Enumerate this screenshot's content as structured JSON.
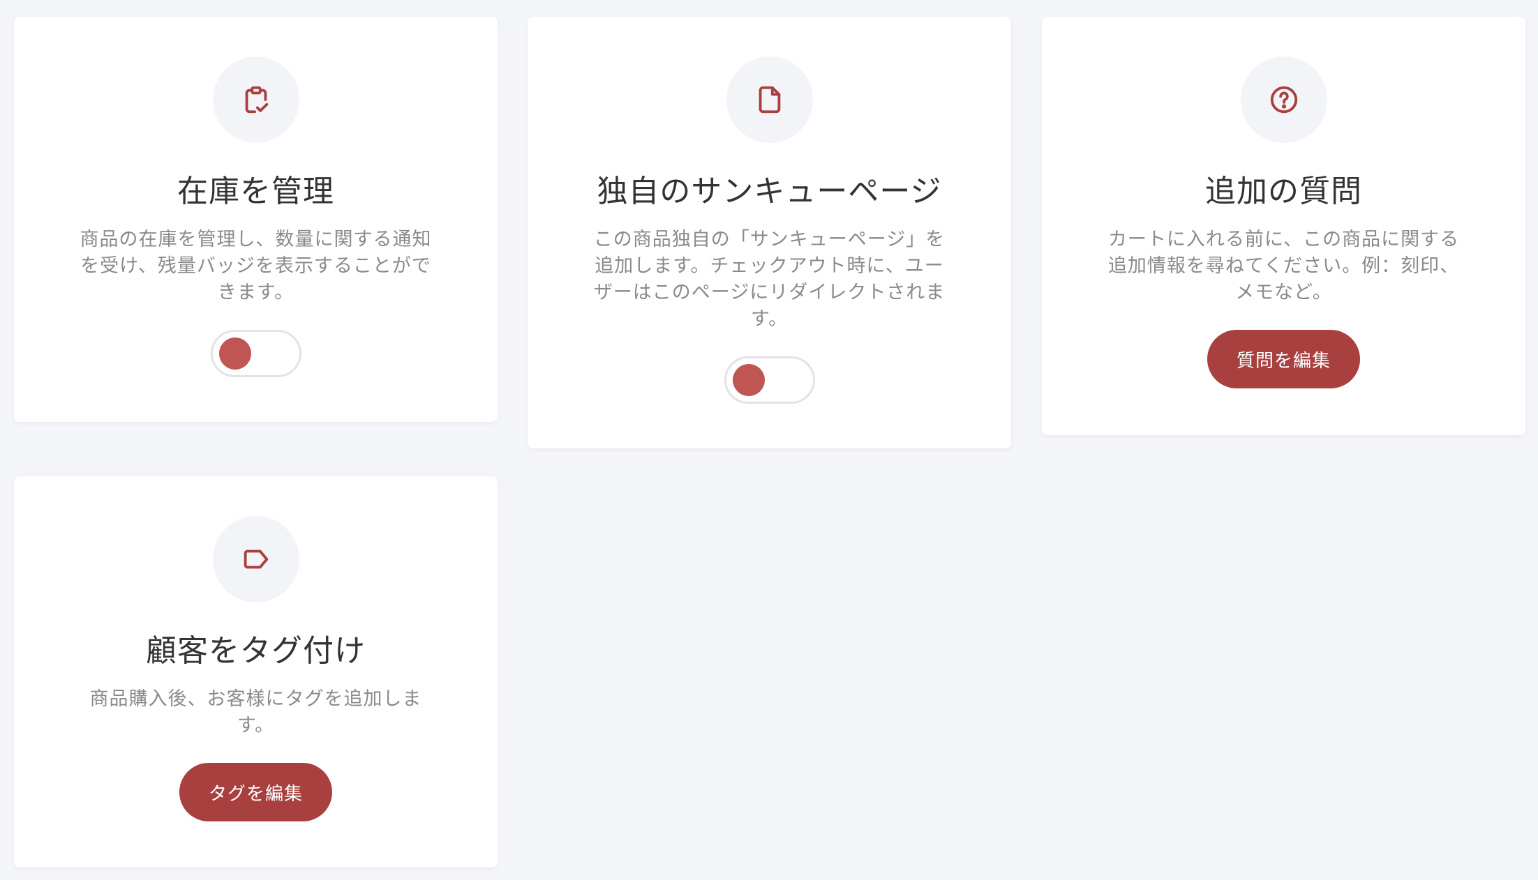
{
  "theme": {
    "accent": "#a7403e",
    "toggle_knob": "#c05653",
    "background": "#f4f5f9"
  },
  "cards": [
    {
      "id": "inventory",
      "icon": "clipboard-check-icon",
      "title": "在庫を管理",
      "description": "商品の在庫を管理し、数量に関する通知を受け、残量バッジを表示することができます。",
      "control": "toggle",
      "toggle_on": false
    },
    {
      "id": "thankyou",
      "icon": "document-icon",
      "title": "独自のサンキューページ",
      "description": "この商品独自の「サンキューページ」を追加します。チェックアウト時に、ユーザーはこのページにリダイレクトされます。",
      "control": "toggle",
      "toggle_on": false
    },
    {
      "id": "questions",
      "icon": "question-circle-icon",
      "title": "追加の質問",
      "description": "カートに入れる前に、この商品に関する追加情報を尋ねてください。例：刻印、メモなど。",
      "control": "button",
      "button_label": "質問を編集"
    },
    {
      "id": "tags",
      "icon": "tag-icon",
      "title": "顧客をタグ付け",
      "description": "商品購入後、お客様にタグを追加します。",
      "control": "button",
      "button_label": "タグを編集"
    }
  ]
}
